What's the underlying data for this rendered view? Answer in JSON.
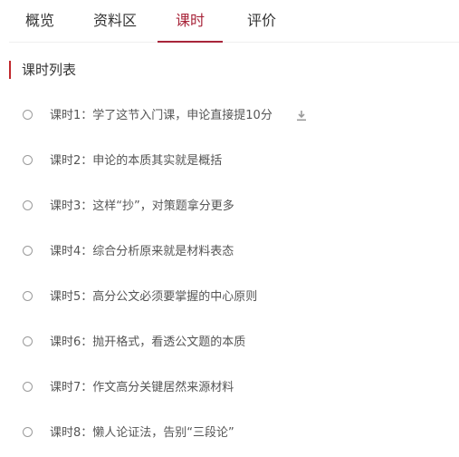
{
  "tabs": [
    {
      "label": "概览"
    },
    {
      "label": "资料区"
    },
    {
      "label": "课时"
    },
    {
      "label": "评价"
    }
  ],
  "active_tab": "课时",
  "accent_color": "#a8253a",
  "section": {
    "title": "课时列表"
  },
  "lessons": [
    {
      "title": "课时1：学了这节入门课，申论直接提10分",
      "download_icon": "download-icon"
    },
    {
      "title": "课时2：申论的本质其实就是概括"
    },
    {
      "title": "课时3：这样“抄”，对策题拿分更多"
    },
    {
      "title": "课时4：综合分析原来就是材料表态"
    },
    {
      "title": "课时5：高分公文必须要掌握的中心原则"
    },
    {
      "title": "课时6：抛开格式，看透公文题的本质"
    },
    {
      "title": "课时7：作文高分关键居然来源材料"
    },
    {
      "title": "课时8：懒人论证法，告别“三段论”"
    }
  ]
}
